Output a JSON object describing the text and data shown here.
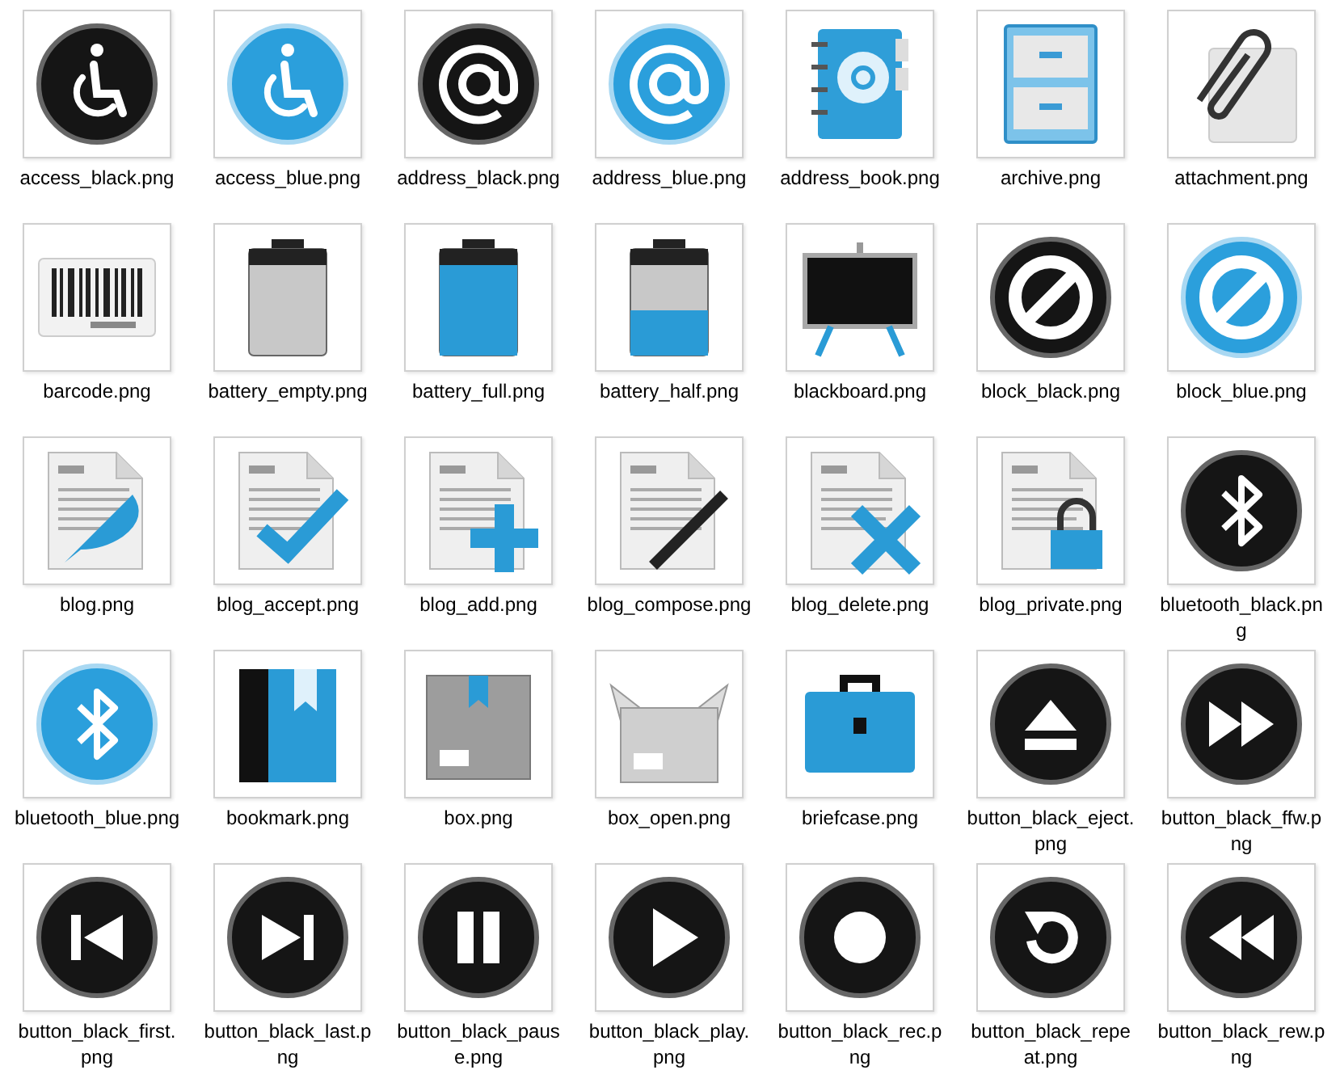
{
  "files": [
    {
      "label": "access_black.png"
    },
    {
      "label": "access_blue.png"
    },
    {
      "label": "address_black.png"
    },
    {
      "label": "address_blue.png"
    },
    {
      "label": "address_book.png"
    },
    {
      "label": "archive.png"
    },
    {
      "label": "attachment.png"
    },
    {
      "label": "barcode.png"
    },
    {
      "label": "battery_empty.png"
    },
    {
      "label": "battery_full.png"
    },
    {
      "label": "battery_half.png"
    },
    {
      "label": "blackboard.png"
    },
    {
      "label": "block_black.png"
    },
    {
      "label": "block_blue.png"
    },
    {
      "label": "blog.png"
    },
    {
      "label": "blog_accept.png"
    },
    {
      "label": "blog_add.png"
    },
    {
      "label": "blog_compose.png"
    },
    {
      "label": "blog_delete.png"
    },
    {
      "label": "blog_private.png"
    },
    {
      "label": "bluetooth_black.png"
    },
    {
      "label": "bluetooth_blue.png"
    },
    {
      "label": "bookmark.png"
    },
    {
      "label": "box.png"
    },
    {
      "label": "box_open.png"
    },
    {
      "label": "briefcase.png"
    },
    {
      "label": "button_black_eject.png"
    },
    {
      "label": "button_black_ffw.png"
    },
    {
      "label": "button_black_first.png"
    },
    {
      "label": "button_black_last.png"
    },
    {
      "label": "button_black_pause.png"
    },
    {
      "label": "button_black_play.png"
    },
    {
      "label": "button_black_rec.png"
    },
    {
      "label": "button_black_repeat.png"
    },
    {
      "label": "button_black_rew.png"
    }
  ]
}
